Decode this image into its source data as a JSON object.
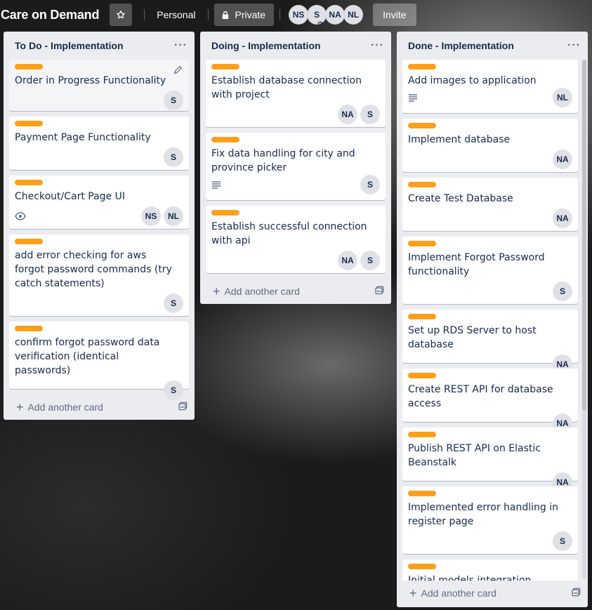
{
  "header": {
    "board_title": "Care on Demand",
    "star_icon": "star-icon",
    "visibility_team": "Personal",
    "visibility_privacy": "Private",
    "lock_icon": "lock-icon",
    "members": [
      "NS",
      "S",
      "NA",
      "NL"
    ],
    "invite_label": "Invite"
  },
  "lists": [
    {
      "title": "To Do - Implementation",
      "menu": "···",
      "add_card_label": "Add another card",
      "cards": [
        {
          "title": "Order in Progress Functionality",
          "members": [
            "S"
          ]
        },
        {
          "title": "Payment Page Functionality",
          "members": [
            "S"
          ]
        },
        {
          "title": "Checkout/Cart Page UI",
          "members": [
            "NS",
            "NL"
          ],
          "badge": "eye-icon"
        },
        {
          "title": "add error checking for aws forgot password commands (try catch statements)",
          "members": [
            "S"
          ]
        },
        {
          "title": "confirm forgot password data verification (identical passwords)",
          "members": [
            "S"
          ]
        }
      ]
    },
    {
      "title": "Doing - Implementation",
      "menu": "···",
      "add_card_label": "Add another card",
      "cards": [
        {
          "title": "Establish database connection with project",
          "members": [
            "NA",
            "S"
          ]
        },
        {
          "title": "Fix data handling for city and province picker",
          "members": [
            "S"
          ],
          "badge": "description-icon"
        },
        {
          "title": "Establish successful connection with api",
          "members": [
            "NA",
            "S"
          ]
        }
      ]
    },
    {
      "title": "Done - Implementation",
      "menu": "···",
      "add_card_label": "Add another card",
      "cards": [
        {
          "title": "Add images to application",
          "members": [
            "NL"
          ],
          "badge": "description-icon"
        },
        {
          "title": "Implement database",
          "members": [
            "NA"
          ]
        },
        {
          "title": "Create Test Database",
          "members": [
            "NA"
          ]
        },
        {
          "title": "Implement Forgot Password functionality",
          "members": [
            "S"
          ]
        },
        {
          "title": "Set up RDS Server to host database",
          "members": [
            "NA"
          ]
        },
        {
          "title": "Create REST API for database access",
          "members": [
            "NA"
          ]
        },
        {
          "title": "Publish REST API on Elastic Beanstalk",
          "members": [
            "NA"
          ]
        },
        {
          "title": "Implemented error handling in register page",
          "members": [
            "S"
          ]
        },
        {
          "title": "Initial models integration",
          "members": []
        }
      ]
    }
  ],
  "colors": {
    "label_orange": "#ff9f1a",
    "list_bg": "#ebecf0",
    "text_primary": "#172b4d",
    "text_secondary": "#5e6c84"
  }
}
